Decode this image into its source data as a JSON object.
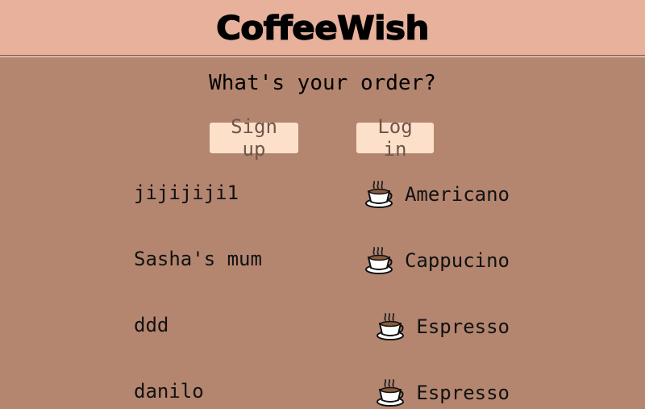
{
  "header": {
    "title": "CoffeeWish"
  },
  "main": {
    "question": "What's your order?",
    "signup_label": "Sign up",
    "login_label": "Log in"
  },
  "orders": [
    {
      "name": "jijijiji1",
      "drink": "Americano",
      "icon": "coffee-cup-icon"
    },
    {
      "name": "Sasha's mum",
      "drink": "Cappucino",
      "icon": "coffee-cup-icon"
    },
    {
      "name": "ddd",
      "drink": "Espresso",
      "icon": "coffee-cup-icon"
    },
    {
      "name": "danilo",
      "drink": "Espresso",
      "icon": "coffee-cup-icon"
    }
  ],
  "colors": {
    "header_bg": "#e7b19b",
    "page_bg": "#b48670",
    "button_bg": "#fde0c9",
    "button_text": "#6e564a"
  }
}
